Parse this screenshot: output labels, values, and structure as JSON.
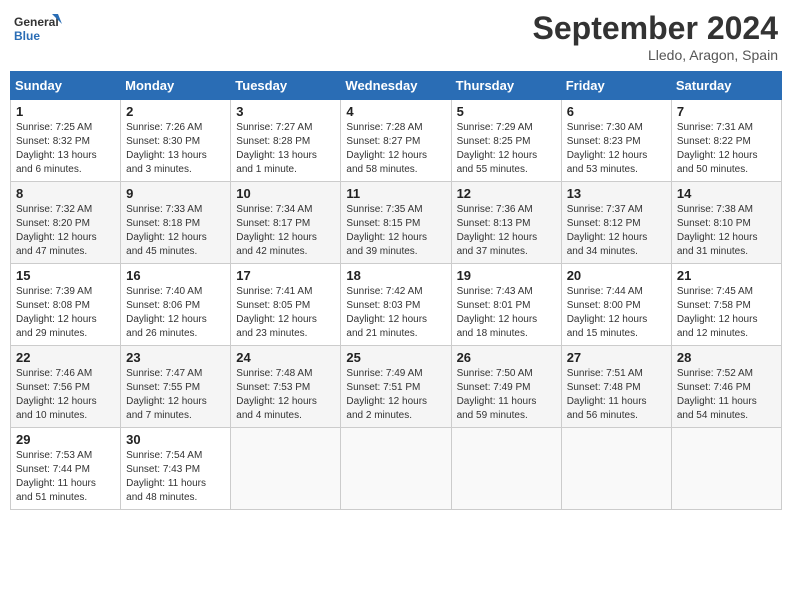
{
  "header": {
    "logo_general": "General",
    "logo_blue": "Blue",
    "month_title": "September 2024",
    "location": "Lledo, Aragon, Spain"
  },
  "days_of_week": [
    "Sunday",
    "Monday",
    "Tuesday",
    "Wednesday",
    "Thursday",
    "Friday",
    "Saturday"
  ],
  "weeks": [
    [
      {
        "day": "1",
        "sunrise": "7:25 AM",
        "sunset": "8:32 PM",
        "daylight": "13 hours and 6 minutes."
      },
      {
        "day": "2",
        "sunrise": "7:26 AM",
        "sunset": "8:30 PM",
        "daylight": "13 hours and 3 minutes."
      },
      {
        "day": "3",
        "sunrise": "7:27 AM",
        "sunset": "8:28 PM",
        "daylight": "13 hours and 1 minute."
      },
      {
        "day": "4",
        "sunrise": "7:28 AM",
        "sunset": "8:27 PM",
        "daylight": "12 hours and 58 minutes."
      },
      {
        "day": "5",
        "sunrise": "7:29 AM",
        "sunset": "8:25 PM",
        "daylight": "12 hours and 55 minutes."
      },
      {
        "day": "6",
        "sunrise": "7:30 AM",
        "sunset": "8:23 PM",
        "daylight": "12 hours and 53 minutes."
      },
      {
        "day": "7",
        "sunrise": "7:31 AM",
        "sunset": "8:22 PM",
        "daylight": "12 hours and 50 minutes."
      }
    ],
    [
      {
        "day": "8",
        "sunrise": "7:32 AM",
        "sunset": "8:20 PM",
        "daylight": "12 hours and 47 minutes."
      },
      {
        "day": "9",
        "sunrise": "7:33 AM",
        "sunset": "8:18 PM",
        "daylight": "12 hours and 45 minutes."
      },
      {
        "day": "10",
        "sunrise": "7:34 AM",
        "sunset": "8:17 PM",
        "daylight": "12 hours and 42 minutes."
      },
      {
        "day": "11",
        "sunrise": "7:35 AM",
        "sunset": "8:15 PM",
        "daylight": "12 hours and 39 minutes."
      },
      {
        "day": "12",
        "sunrise": "7:36 AM",
        "sunset": "8:13 PM",
        "daylight": "12 hours and 37 minutes."
      },
      {
        "day": "13",
        "sunrise": "7:37 AM",
        "sunset": "8:12 PM",
        "daylight": "12 hours and 34 minutes."
      },
      {
        "day": "14",
        "sunrise": "7:38 AM",
        "sunset": "8:10 PM",
        "daylight": "12 hours and 31 minutes."
      }
    ],
    [
      {
        "day": "15",
        "sunrise": "7:39 AM",
        "sunset": "8:08 PM",
        "daylight": "12 hours and 29 minutes."
      },
      {
        "day": "16",
        "sunrise": "7:40 AM",
        "sunset": "8:06 PM",
        "daylight": "12 hours and 26 minutes."
      },
      {
        "day": "17",
        "sunrise": "7:41 AM",
        "sunset": "8:05 PM",
        "daylight": "12 hours and 23 minutes."
      },
      {
        "day": "18",
        "sunrise": "7:42 AM",
        "sunset": "8:03 PM",
        "daylight": "12 hours and 21 minutes."
      },
      {
        "day": "19",
        "sunrise": "7:43 AM",
        "sunset": "8:01 PM",
        "daylight": "12 hours and 18 minutes."
      },
      {
        "day": "20",
        "sunrise": "7:44 AM",
        "sunset": "8:00 PM",
        "daylight": "12 hours and 15 minutes."
      },
      {
        "day": "21",
        "sunrise": "7:45 AM",
        "sunset": "7:58 PM",
        "daylight": "12 hours and 12 minutes."
      }
    ],
    [
      {
        "day": "22",
        "sunrise": "7:46 AM",
        "sunset": "7:56 PM",
        "daylight": "12 hours and 10 minutes."
      },
      {
        "day": "23",
        "sunrise": "7:47 AM",
        "sunset": "7:55 PM",
        "daylight": "12 hours and 7 minutes."
      },
      {
        "day": "24",
        "sunrise": "7:48 AM",
        "sunset": "7:53 PM",
        "daylight": "12 hours and 4 minutes."
      },
      {
        "day": "25",
        "sunrise": "7:49 AM",
        "sunset": "7:51 PM",
        "daylight": "12 hours and 2 minutes."
      },
      {
        "day": "26",
        "sunrise": "7:50 AM",
        "sunset": "7:49 PM",
        "daylight": "11 hours and 59 minutes."
      },
      {
        "day": "27",
        "sunrise": "7:51 AM",
        "sunset": "7:48 PM",
        "daylight": "11 hours and 56 minutes."
      },
      {
        "day": "28",
        "sunrise": "7:52 AM",
        "sunset": "7:46 PM",
        "daylight": "11 hours and 54 minutes."
      }
    ],
    [
      {
        "day": "29",
        "sunrise": "7:53 AM",
        "sunset": "7:44 PM",
        "daylight": "11 hours and 51 minutes."
      },
      {
        "day": "30",
        "sunrise": "7:54 AM",
        "sunset": "7:43 PM",
        "daylight": "11 hours and 48 minutes."
      },
      null,
      null,
      null,
      null,
      null
    ]
  ]
}
